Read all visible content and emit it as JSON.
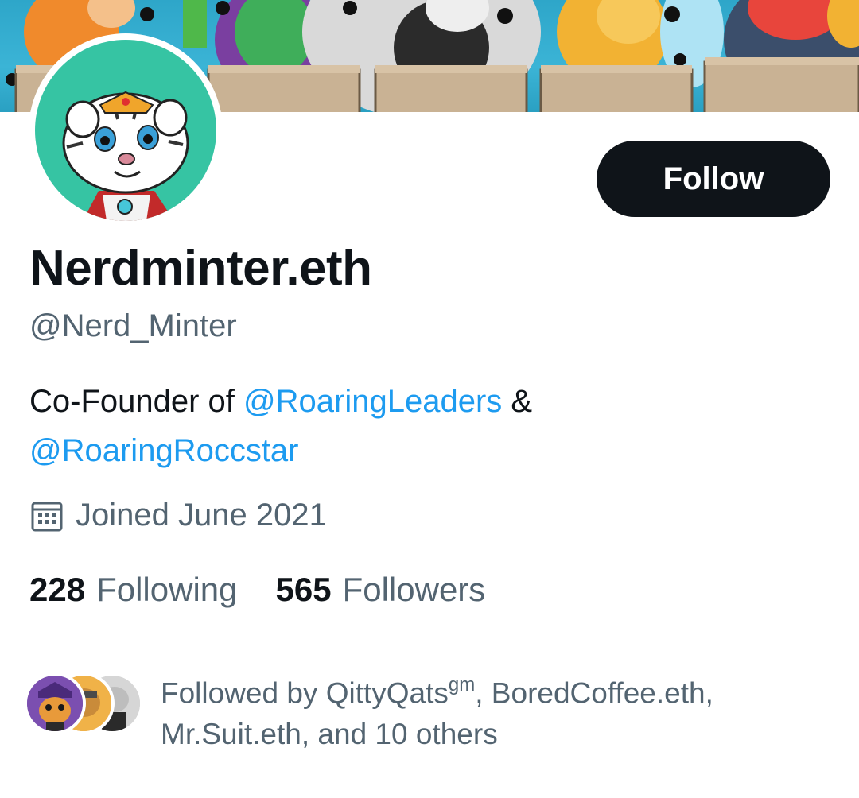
{
  "profile": {
    "display_name": "Nerdminter.eth",
    "handle": "@Nerd_Minter",
    "bio_prefix": "Co-Founder of ",
    "bio_mention_1": "@RoaringLeaders",
    "bio_middle": " & ",
    "bio_mention_2": "@RoaringRoccstar",
    "joined": "Joined June 2021"
  },
  "actions": {
    "follow_label": "Follow"
  },
  "stats": {
    "following_count": "228",
    "following_label": "Following",
    "followers_count": "565",
    "followers_label": "Followers"
  },
  "followed_by": {
    "prefix": "Followed by QittyQats",
    "superscript": "gm",
    "rest": ", BoredCoffee.eth, Mr.Suit.eth, and 10 others"
  },
  "icons": {
    "calendar": "calendar-icon"
  },
  "colors": {
    "link": "#1d9bf0",
    "secondary_text": "#536471",
    "primary_text": "#0f1419",
    "avatar_bg": "#36c4a3"
  }
}
